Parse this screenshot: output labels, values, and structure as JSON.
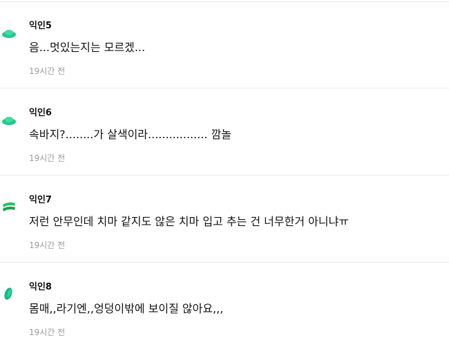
{
  "comments": [
    {
      "author": "익인5",
      "text": "음...멋있는지는 모르겠...",
      "time": "19시간 전",
      "avatar_color": "#1fc98e"
    },
    {
      "author": "익인6",
      "text": "속바지?........가 살색이라................. 깜놀",
      "time": "19시간 전",
      "avatar_color": "#1fc98e"
    },
    {
      "author": "익인7",
      "text": "저런 안무인데 치마 같지도 않은 치마 입고 추는 건 너무한거 아니냐ㅠ",
      "time": "19시간 전",
      "avatar_color": "#22c55e"
    },
    {
      "author": "익인8",
      "text": "몸매,,라기엔,,엉덩이밖에 보이질 않아요,,,",
      "time": "19시간 전",
      "avatar_color": "#10b981"
    }
  ],
  "icons": {
    "avatar_5": "cloud-avatar-icon",
    "avatar_6": "cloud-avatar-icon",
    "avatar_7": "stacked-avatar-icon",
    "avatar_8": "leaf-avatar-icon"
  }
}
